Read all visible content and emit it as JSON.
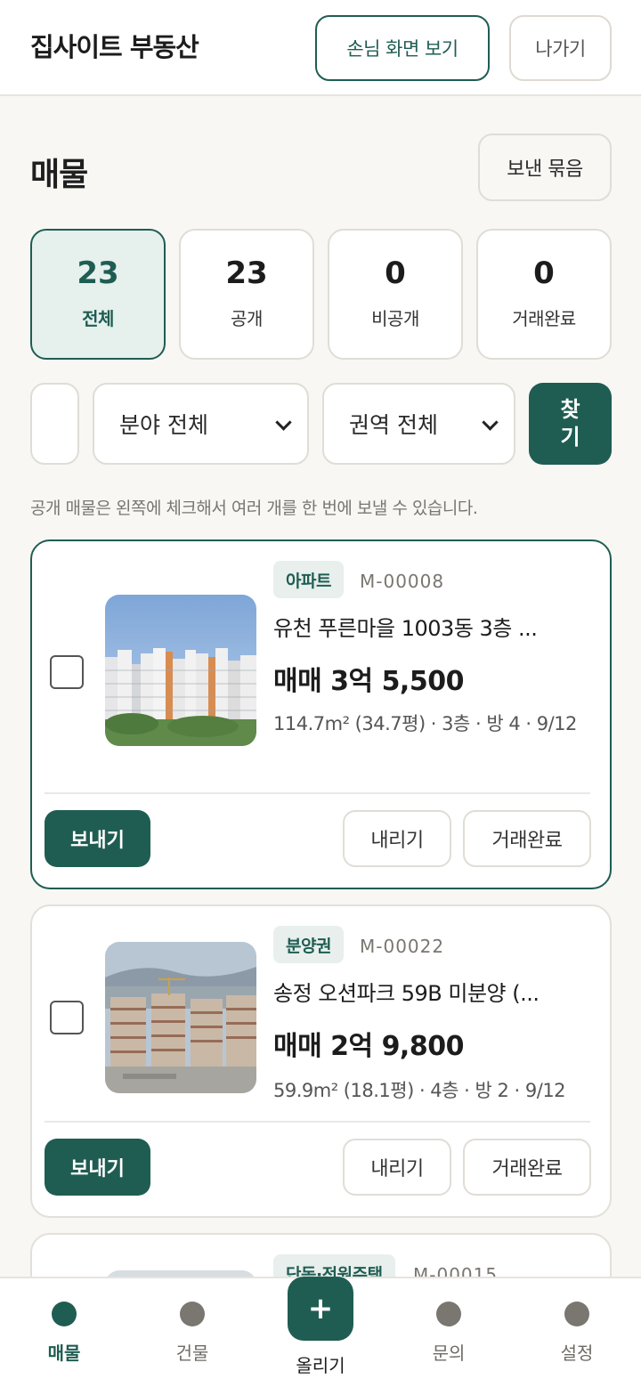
{
  "header": {
    "title": "집사이트 부동산",
    "guest_view_label": "손님 화면 보기",
    "exit_label": "나가기"
  },
  "section": {
    "title": "매물",
    "sent_bundle_label": "보낸 묶음"
  },
  "stats": [
    {
      "count": "23",
      "label": "전체",
      "active": true
    },
    {
      "count": "23",
      "label": "공개",
      "active": false
    },
    {
      "count": "0",
      "label": "비공개",
      "active": false
    },
    {
      "count": "0",
      "label": "거래완료",
      "active": false
    }
  ],
  "filters": {
    "search_value": "",
    "field_selected": "분야 전체",
    "region_selected": "권역 전체",
    "find_label": "찾기"
  },
  "hint": "공개 매물은 왼쪽에 체크해서 여러 개를 한 번에 보낼 수 있습니다.",
  "listings": [
    {
      "tag": "아파트",
      "code": "M-00008",
      "title": "유천 푸른마을 1003동 3층 ...",
      "price": "매매 3억 5,500",
      "meta": "114.7m² (34.7평) · 3층 · 방 4 · 9/12",
      "send_label": "보내기",
      "unlist_label": "내리기",
      "complete_label": "거래완료"
    },
    {
      "tag": "분양권",
      "code": "M-00022",
      "title": "송정 오션파크 59B 미분양 (...",
      "price": "매매 2억 9,800",
      "meta": "59.9m² (18.1평) · 4층 · 방 2 · 9/12",
      "send_label": "보내기",
      "unlist_label": "내리기",
      "complete_label": "거래완료"
    },
    {
      "tag": "단독·전원주택",
      "code": "M-00015"
    }
  ],
  "bottom_nav": [
    {
      "label": "매물",
      "active": true
    },
    {
      "label": "건물",
      "active": false
    },
    {
      "label": "올리기",
      "icon": "+"
    },
    {
      "label": "문의",
      "active": false
    },
    {
      "label": "설정",
      "active": false
    }
  ],
  "colors": {
    "primary": "#1f5d52",
    "background": "#f8f7f4",
    "tag_bg": "#e8efec"
  }
}
